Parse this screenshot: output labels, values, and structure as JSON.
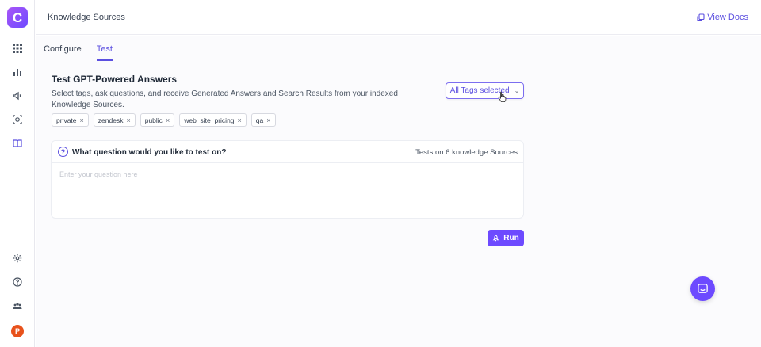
{
  "app": {
    "logo_letter": "C",
    "brand_color": "#6d4aff"
  },
  "sidebar": {
    "items": [
      {
        "name": "grid-icon"
      },
      {
        "name": "chart-icon"
      },
      {
        "name": "megaphone-icon"
      },
      {
        "name": "scan-icon"
      },
      {
        "name": "book-icon",
        "active": true
      }
    ],
    "bottom": [
      {
        "name": "settings-icon"
      },
      {
        "name": "help-icon"
      },
      {
        "name": "team-icon"
      }
    ],
    "avatar_letter": "P"
  },
  "header": {
    "title": "Knowledge Sources",
    "docs_label": "View Docs"
  },
  "tabs": [
    {
      "label": "Configure",
      "active": false
    },
    {
      "label": "Test",
      "active": true
    }
  ],
  "test_section": {
    "title": "Test GPT-Powered Answers",
    "description": "Select tags, ask questions, and receive Generated Answers and Search Results from your indexed Knowledge Sources.",
    "tag_select_label": "All Tags selected",
    "tags": [
      "private",
      "zendesk",
      "public",
      "web_site_pricing",
      "qa"
    ]
  },
  "question_card": {
    "question": "What question would you like to test on?",
    "tests_info": "Tests on 6 knowledge Sources",
    "input_placeholder": "Enter your question here",
    "input_value": ""
  },
  "run_button": {
    "label": "Run"
  }
}
